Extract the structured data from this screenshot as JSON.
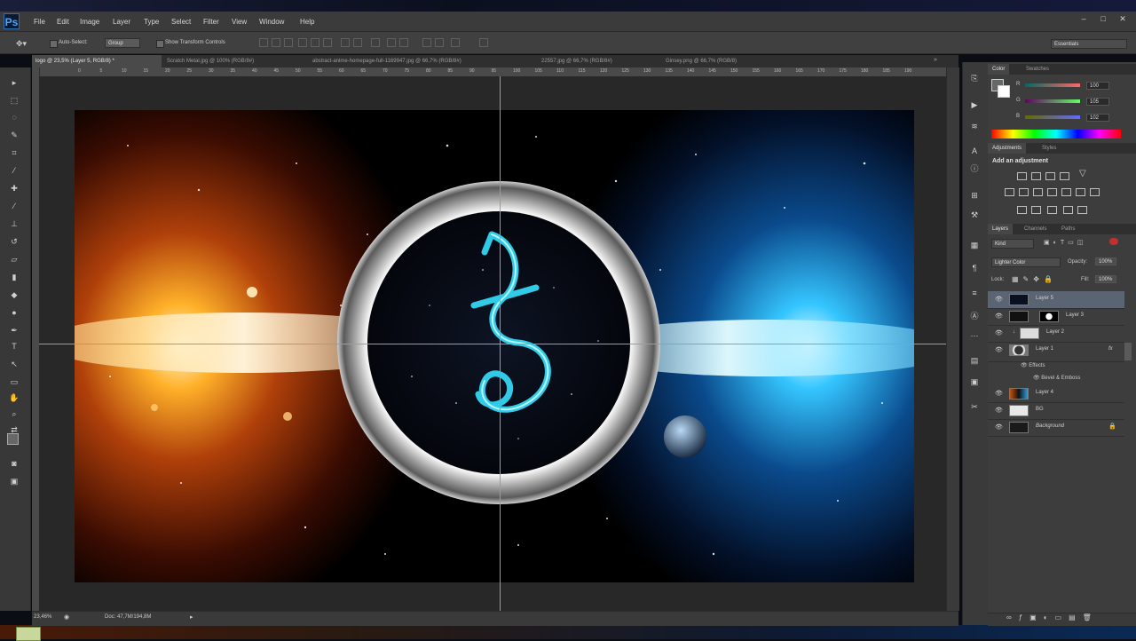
{
  "app": {
    "logo": "Ps"
  },
  "menu": [
    "File",
    "Edit",
    "Image",
    "Layer",
    "Type",
    "Select",
    "Filter",
    "View",
    "Window",
    "Help"
  ],
  "window_controls": {
    "minimize": "–",
    "maximize": "□",
    "close": "✕"
  },
  "options_bar": {
    "auto_select_label": "Auto-Select:",
    "auto_select_value": "Group",
    "show_transform_label": "Show Transform Controls",
    "workspace": "Essentials"
  },
  "tabs": [
    {
      "label": "logo @ 23,5% (Layer 5, RGB/8) *",
      "active": true
    },
    {
      "label": "Scratch Metal.jpg @ 100% (RGB/8#)",
      "active": false
    },
    {
      "label": "abstract-anime-homepage-full-1169947.jpg @ 66,7% (RGB/8#)",
      "active": false
    },
    {
      "label": "22557.jpg @ 66,7% (RGB/8#)",
      "active": false
    },
    {
      "label": "Ginsey.png @ 66,7% (RGB/8)",
      "active": false
    }
  ],
  "ruler_ticks": [
    "0",
    "5",
    "10",
    "15",
    "20",
    "25",
    "30",
    "35",
    "40",
    "45",
    "50",
    "55",
    "60",
    "65",
    "70",
    "75",
    "80",
    "85",
    "90",
    "95",
    "100",
    "105",
    "110",
    "115",
    "120",
    "125",
    "130",
    "135",
    "140",
    "145",
    "150",
    "155",
    "160",
    "165",
    "170",
    "175",
    "180",
    "185",
    "190"
  ],
  "status": {
    "zoom": "23,46%",
    "doc": "Doc: 47,7M/194,8M"
  },
  "color_panel": {
    "tabs": [
      "Color",
      "Swatches"
    ],
    "channels": [
      {
        "label": "R",
        "value": "100"
      },
      {
        "label": "G",
        "value": "105"
      },
      {
        "label": "B",
        "value": "102"
      }
    ]
  },
  "adjustments_panel": {
    "tabs": [
      "Adjustments",
      "Styles"
    ],
    "title": "Add an adjustment"
  },
  "layers_panel": {
    "tabs": [
      "Layers",
      "Channels",
      "Paths"
    ],
    "kind": "Kind",
    "blend_mode": "Lighter Color",
    "opacity_label": "Opacity:",
    "opacity_value": "100%",
    "lock_label": "Lock:",
    "fill_label": "Fill:",
    "fill_value": "100%",
    "layers": [
      {
        "name": "Layer 5",
        "selected": true
      },
      {
        "name": "Layer 3",
        "selected": false
      },
      {
        "name": "Layer 2",
        "selected": false
      },
      {
        "name": "Layer 1",
        "selected": false,
        "fx": "fx"
      },
      {
        "name": "Effects",
        "sub": true
      },
      {
        "name": "Bevel & Emboss",
        "sub": true
      },
      {
        "name": "Layer 4",
        "selected": false
      },
      {
        "name": "BG",
        "selected": false
      },
      {
        "name": "Background",
        "selected": false,
        "locked": true
      }
    ]
  },
  "colors": {
    "accent_guide": "#2ec8d8",
    "selected_layer": "#5a6473"
  }
}
